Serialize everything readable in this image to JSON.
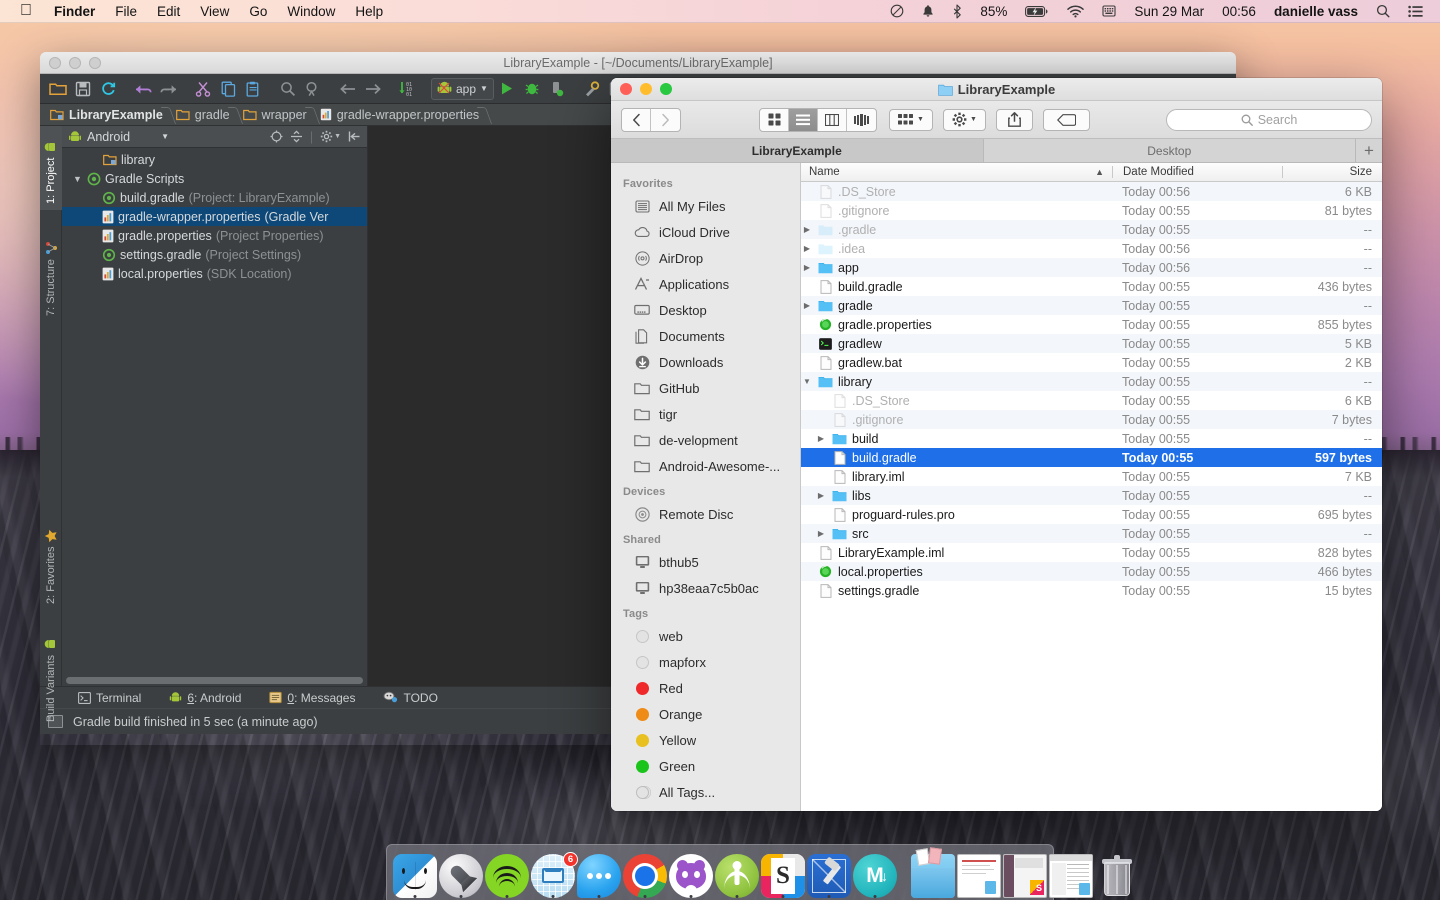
{
  "menubar": {
    "apple": "apple-logo",
    "items": [
      {
        "label": "Finder",
        "bold": true
      },
      {
        "label": "File",
        "bold": false
      },
      {
        "label": "Edit",
        "bold": false
      },
      {
        "label": "View",
        "bold": false
      },
      {
        "label": "Go",
        "bold": false
      },
      {
        "label": "Window",
        "bold": false
      },
      {
        "label": "Help",
        "bold": false
      }
    ],
    "status": {
      "do_not_disturb": "do-not-disturb-icon",
      "notification": "bell-icon",
      "bluetooth": "bluetooth-icon",
      "battery_percent": "85%",
      "battery": "battery-charging-icon",
      "wifi": "wifi-icon",
      "input_source": "input-source-icon",
      "date": "Sun 29 Mar",
      "time": "00:56",
      "user": "danielle vass",
      "search": "spotlight-search-icon",
      "notification_center": "notification-center-icon"
    }
  },
  "studio": {
    "title": "LibraryExample - [~/Documents/LibraryExample]",
    "toolbar_icons": [
      "open-folder-icon",
      "save-all-icon",
      "sync-icon",
      "undo-icon",
      "redo-icon",
      "cut-icon",
      "copy-icon",
      "paste-icon",
      "find-icon",
      "replace-icon",
      "back-icon",
      "forward-icon",
      "compile-icon"
    ],
    "run_config": "app",
    "run_icons": [
      "run-icon",
      "debug-icon",
      "attach-debugger-icon",
      "sdk-manager-icon",
      "avd-manager-icon"
    ],
    "breadcrumb": [
      {
        "label": "LibraryExample",
        "icon": "module-icon"
      },
      {
        "label": "gradle",
        "icon": "folder-icon"
      },
      {
        "label": "wrapper",
        "icon": "folder-icon"
      },
      {
        "label": "gradle-wrapper.properties",
        "icon": "properties-file-icon"
      }
    ],
    "rail_tabs": [
      {
        "label": "1: Project",
        "selected": true,
        "icon": "android-icon"
      },
      {
        "label": "7: Structure",
        "selected": false,
        "icon": "structure-icon"
      },
      {
        "label": "2: Favorites",
        "selected": false,
        "icon": "star-icon"
      },
      {
        "label": "Build Variants",
        "selected": false,
        "icon": "android-icon"
      }
    ],
    "pane": {
      "view_selector": "Android",
      "tools": [
        "target-icon",
        "collapse-icon",
        "settings-gear-icon",
        "hide-icon"
      ]
    },
    "tree": [
      {
        "label": "library",
        "detail": "",
        "icon": "module-icon",
        "twisty": "",
        "indent": 1,
        "selected": false
      },
      {
        "label": "Gradle Scripts",
        "detail": "",
        "icon": "gradle-icon",
        "twisty": "open",
        "indent": 0,
        "selected": false
      },
      {
        "label": "build.gradle",
        "detail": "(Project: LibraryExample)",
        "icon": "gradle-icon",
        "twisty": "",
        "indent": 2,
        "selected": false
      },
      {
        "label": "gradle-wrapper.properties",
        "detail": "(Gradle Ver",
        "icon": "properties-file-icon",
        "twisty": "",
        "indent": 2,
        "selected": true
      },
      {
        "label": "gradle.properties",
        "detail": "(Project Properties)",
        "icon": "properties-file-icon",
        "twisty": "",
        "indent": 2,
        "selected": false
      },
      {
        "label": "settings.gradle",
        "detail": "(Project Settings)",
        "icon": "gradle-icon",
        "twisty": "",
        "indent": 2,
        "selected": false
      },
      {
        "label": "local.properties",
        "detail": "(SDK Location)",
        "icon": "properties-file-icon",
        "twisty": "",
        "indent": 2,
        "selected": false
      }
    ],
    "bottom_buttons": [
      {
        "label": "Terminal",
        "icon": "terminal-icon",
        "accel": ""
      },
      {
        "label": ": Android",
        "icon": "android-icon",
        "accel": "6"
      },
      {
        "label": ": Messages",
        "icon": "messages-icon",
        "accel": "0"
      },
      {
        "label": "TODO",
        "icon": "todo-icon",
        "accel": ""
      }
    ],
    "status_text": "Gradle build finished in 5 sec (a minute ago)"
  },
  "finder": {
    "title": "LibraryExample",
    "title_icon": "folder-icon",
    "nav": {
      "back": "back-chevron-icon",
      "forward": "forward-chevron-icon"
    },
    "view_modes": [
      {
        "name": "icon-view-icon",
        "active": false
      },
      {
        "name": "list-view-icon",
        "active": true
      },
      {
        "name": "column-view-icon",
        "active": false
      },
      {
        "name": "coverflow-view-icon",
        "active": false
      }
    ],
    "arrange_icon": "arrange-icon",
    "action_icon": "action-gear-icon",
    "share_icon": "share-icon",
    "tag_icon": "tag-icon",
    "search_placeholder": "Search",
    "search_icon": "search-icon",
    "tabs": [
      {
        "label": "LibraryExample",
        "active": true
      },
      {
        "label": "Desktop",
        "active": false
      }
    ],
    "tab_add": "+",
    "sidebar": [
      {
        "section": "Favorites",
        "items": [
          {
            "label": "All My Files",
            "icon": "all-my-files-icon"
          },
          {
            "label": "iCloud Drive",
            "icon": "icloud-icon"
          },
          {
            "label": "AirDrop",
            "icon": "airdrop-icon"
          },
          {
            "label": "Applications",
            "icon": "applications-icon"
          },
          {
            "label": "Desktop",
            "icon": "desktop-icon"
          },
          {
            "label": "Documents",
            "icon": "documents-icon"
          },
          {
            "label": "Downloads",
            "icon": "downloads-icon"
          },
          {
            "label": "GitHub",
            "icon": "folder-icon"
          },
          {
            "label": "tigr",
            "icon": "folder-icon"
          },
          {
            "label": "de-velopment",
            "icon": "folder-icon"
          },
          {
            "label": "Android-Awesome-...",
            "icon": "folder-icon"
          }
        ]
      },
      {
        "section": "Devices",
        "items": [
          {
            "label": "Remote Disc",
            "icon": "remote-disc-icon"
          }
        ]
      },
      {
        "section": "Shared",
        "items": [
          {
            "label": "bthub5",
            "icon": "display-icon"
          },
          {
            "label": "hp38eaa7c5b0ac",
            "icon": "display-icon"
          }
        ]
      },
      {
        "section": "Tags",
        "items": [
          {
            "label": "web",
            "icon": "tag-dot",
            "color": "#d6d6d6"
          },
          {
            "label": "mapforx",
            "icon": "tag-dot",
            "color": "#d6d6d6"
          },
          {
            "label": "Red",
            "icon": "tag-dot",
            "color": "#ef2929"
          },
          {
            "label": "Orange",
            "icon": "tag-dot",
            "color": "#ef8b17"
          },
          {
            "label": "Yellow",
            "icon": "tag-dot",
            "color": "#e8c020"
          },
          {
            "label": "Green",
            "icon": "tag-dot",
            "color": "#1bc41b"
          },
          {
            "label": "All Tags...",
            "icon": "all-tags-icon",
            "color": "#d6d6d6"
          }
        ]
      }
    ],
    "columns": {
      "name": "Name",
      "date": "Date Modified",
      "size": "Size",
      "sort_arrow": "▲"
    },
    "rows": [
      {
        "name": ".DS_Store",
        "date": "Today 00:56",
        "size": "6 KB",
        "icon": "file-icon",
        "indent": 0,
        "twisty": "",
        "dim": true,
        "selected": false
      },
      {
        "name": ".gitignore",
        "date": "Today 00:55",
        "size": "81 bytes",
        "icon": "file-icon",
        "indent": 0,
        "twisty": "",
        "dim": true,
        "selected": false
      },
      {
        "name": ".gradle",
        "date": "Today 00:55",
        "size": "--",
        "icon": "folder-icon-dim",
        "indent": 0,
        "twisty": "closed",
        "dim": true,
        "selected": false
      },
      {
        "name": ".idea",
        "date": "Today 00:56",
        "size": "--",
        "icon": "folder-icon-dim",
        "indent": 0,
        "twisty": "closed",
        "dim": true,
        "selected": false
      },
      {
        "name": "app",
        "date": "Today 00:56",
        "size": "--",
        "icon": "folder-icon",
        "indent": 0,
        "twisty": "closed",
        "dim": false,
        "selected": false
      },
      {
        "name": "build.gradle",
        "date": "Today 00:55",
        "size": "436 bytes",
        "icon": "file-icon",
        "indent": 0,
        "twisty": "",
        "dim": false,
        "selected": false
      },
      {
        "name": "gradle",
        "date": "Today 00:55",
        "size": "--",
        "icon": "folder-icon",
        "indent": 0,
        "twisty": "closed",
        "dim": false,
        "selected": false
      },
      {
        "name": "gradle.properties",
        "date": "Today 00:55",
        "size": "855 bytes",
        "icon": "properties-icon",
        "indent": 0,
        "twisty": "",
        "dim": false,
        "selected": false
      },
      {
        "name": "gradlew",
        "date": "Today 00:55",
        "size": "5 KB",
        "icon": "unix-exec-icon",
        "indent": 0,
        "twisty": "",
        "dim": false,
        "selected": false
      },
      {
        "name": "gradlew.bat",
        "date": "Today 00:55",
        "size": "2 KB",
        "icon": "file-icon",
        "indent": 0,
        "twisty": "",
        "dim": false,
        "selected": false
      },
      {
        "name": "library",
        "date": "Today 00:55",
        "size": "--",
        "icon": "folder-icon",
        "indent": 0,
        "twisty": "open",
        "dim": false,
        "selected": false
      },
      {
        "name": ".DS_Store",
        "date": "Today 00:55",
        "size": "6 KB",
        "icon": "file-icon",
        "indent": 1,
        "twisty": "",
        "dim": true,
        "selected": false
      },
      {
        "name": ".gitignore",
        "date": "Today 00:55",
        "size": "7 bytes",
        "icon": "file-icon",
        "indent": 1,
        "twisty": "",
        "dim": true,
        "selected": false
      },
      {
        "name": "build",
        "date": "Today 00:55",
        "size": "--",
        "icon": "folder-icon",
        "indent": 1,
        "twisty": "closed",
        "dim": false,
        "selected": false
      },
      {
        "name": "build.gradle",
        "date": "Today 00:55",
        "size": "597 bytes",
        "icon": "file-icon",
        "indent": 1,
        "twisty": "",
        "dim": false,
        "selected": true
      },
      {
        "name": "library.iml",
        "date": "Today 00:55",
        "size": "7 KB",
        "icon": "file-icon",
        "indent": 1,
        "twisty": "",
        "dim": false,
        "selected": false
      },
      {
        "name": "libs",
        "date": "Today 00:55",
        "size": "--",
        "icon": "folder-icon",
        "indent": 1,
        "twisty": "closed",
        "dim": false,
        "selected": false
      },
      {
        "name": "proguard-rules.pro",
        "date": "Today 00:55",
        "size": "695 bytes",
        "icon": "file-icon",
        "indent": 1,
        "twisty": "",
        "dim": false,
        "selected": false
      },
      {
        "name": "src",
        "date": "Today 00:55",
        "size": "--",
        "icon": "folder-icon",
        "indent": 1,
        "twisty": "closed",
        "dim": false,
        "selected": false
      },
      {
        "name": "LibraryExample.iml",
        "date": "Today 00:55",
        "size": "828 bytes",
        "icon": "file-icon",
        "indent": 0,
        "twisty": "",
        "dim": false,
        "selected": false
      },
      {
        "name": "local.properties",
        "date": "Today 00:55",
        "size": "466 bytes",
        "icon": "properties-icon",
        "indent": 0,
        "twisty": "",
        "dim": false,
        "selected": false
      },
      {
        "name": "settings.gradle",
        "date": "Today 00:55",
        "size": "15 bytes",
        "icon": "file-icon",
        "indent": 0,
        "twisty": "",
        "dim": false,
        "selected": false
      }
    ]
  },
  "dock": {
    "items": [
      {
        "name": "finder",
        "running": true,
        "badge": ""
      },
      {
        "name": "launchpad",
        "running": true,
        "badge": ""
      },
      {
        "name": "spotify",
        "running": true,
        "badge": ""
      },
      {
        "name": "mailbox",
        "running": true,
        "badge": "6"
      },
      {
        "name": "messages",
        "running": true,
        "badge": ""
      },
      {
        "name": "chrome",
        "running": true,
        "badge": ""
      },
      {
        "name": "github-desktop",
        "running": true,
        "badge": ""
      },
      {
        "name": "android-studio",
        "running": true,
        "badge": ""
      },
      {
        "name": "sketch",
        "running": true,
        "badge": ""
      },
      {
        "name": "xcode",
        "running": true,
        "badge": ""
      },
      {
        "name": "macdown",
        "running": true,
        "badge": ""
      }
    ],
    "minimized": [
      {
        "name": "downloads-stack"
      },
      {
        "name": "document-window"
      },
      {
        "name": "sketch-window"
      },
      {
        "name": "studio-window"
      },
      {
        "name": "trash"
      }
    ]
  },
  "colors": {
    "selection_blue": "#1e6fe8",
    "studio_chrome": "#3c3f41",
    "studio_tree_selection": "#0d4878",
    "tag_red": "#ef2929",
    "tag_orange": "#ef8b17",
    "tag_yellow": "#e8c020",
    "tag_green": "#1bc41b"
  }
}
